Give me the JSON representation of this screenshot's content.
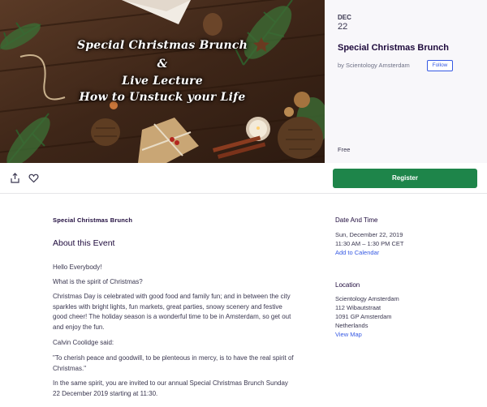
{
  "hero": {
    "line1": "Special Christmas Brunch",
    "line2": "&",
    "line3": "Live Lecture",
    "line4": "How to Unstuck your Life"
  },
  "event": {
    "month": "DEC",
    "day": "22",
    "title": "Special Christmas Brunch",
    "organizer": "by Scientology Amsterdam",
    "follow_label": "Follow",
    "price": "Free"
  },
  "actions": {
    "share_icon": "share-icon",
    "like_icon": "heart-icon",
    "register_label": "Register"
  },
  "main": {
    "summary": "Special Christmas Brunch",
    "about_heading": "About this Event",
    "paragraphs": [
      "Hello Everybody!",
      "What is the spirit of Christmas?",
      "Christmas Day is celebrated with good food and family fun; and in between the city sparkles with bright lights, fun markets, great parties, snowy scenery and festive good cheer! The holiday season is a wonderful time to be in Amsterdam, so get out and enjoy the fun.",
      "Calvin Coolidge said:",
      "\"To cherish peace and goodwill, to be plenteous in mercy, is to have the real spirit of Christmas.\"",
      "In the same spirit, you are invited to our annual Special Christmas Brunch Sunday 22 December 2019 starting at 11:30."
    ]
  },
  "sidebar": {
    "date_heading": "Date And Time",
    "date_line": "Sun, December 22, 2019",
    "time_line": "11:30 AM – 1:30 PM CET",
    "calendar_link": "Add to Calendar",
    "location_heading": "Location",
    "location_lines": [
      "Scientology Amsterdam",
      "112 Wibautstraat",
      "1091 GP Amsterdam",
      "Netherlands"
    ],
    "map_link": "View Map"
  },
  "colors": {
    "register": "#1e854a",
    "link": "#3659e3",
    "title": "#1e0a3c"
  }
}
